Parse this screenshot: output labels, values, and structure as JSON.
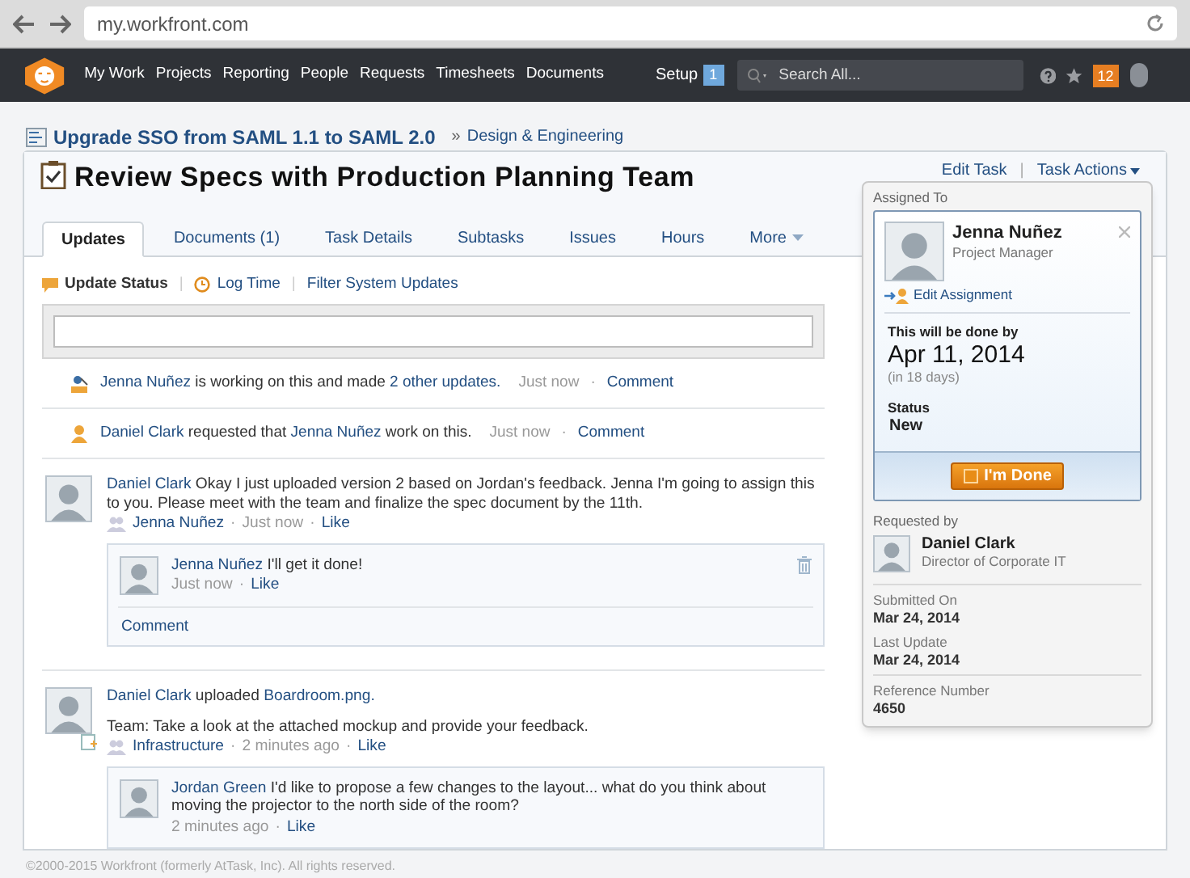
{
  "browser": {
    "url": "my.workfront.com"
  },
  "nav": {
    "items": [
      "My Work",
      "Projects",
      "Reporting",
      "People",
      "Requests",
      "Timesheets",
      "Documents"
    ],
    "setup": "Setup",
    "setup_badge": "1",
    "search_placeholder": "Search All...",
    "notification_count": "12"
  },
  "breadcrumb": {
    "project": "Upgrade SSO from SAML 1.1 to SAML 2.0",
    "separator": "»",
    "group": "Design & Engineering"
  },
  "task": {
    "title": "Review Specs with Production Planning Team",
    "actions": [
      "Edit Task",
      "Task Actions"
    ],
    "action_separator": "|"
  },
  "tabs": [
    {
      "label": "Updates",
      "selected": true
    },
    {
      "label": "Documents",
      "count": "(1)",
      "selected": false
    },
    {
      "label": "Task Details",
      "selected": false
    },
    {
      "label": "Subtasks",
      "selected": false
    },
    {
      "label": "Issues",
      "selected": false
    },
    {
      "label": "Hours",
      "selected": false
    },
    {
      "label": "More",
      "selected": false,
      "dropdown": true
    }
  ],
  "update_bar": {
    "actions": [
      {
        "kind": "status",
        "label": "Update Status",
        "selected": true
      },
      {
        "kind": "time",
        "label": "Log Time",
        "selected": false
      },
      {
        "kind": "filter",
        "label": "Filter System Updates",
        "selected": false
      }
    ],
    "separator": "|"
  },
  "feed": [
    {
      "kind": "system",
      "segments": [
        {
          "text": "Jenna Nuñez",
          "link": true
        },
        {
          "text": " is working on this and made ",
          "link": false
        },
        {
          "text": "2 other updates.",
          "link": true
        }
      ],
      "time": "Just now",
      "separator": "·",
      "action": "Comment"
    },
    {
      "kind": "system",
      "segments": [
        {
          "text": "Daniel Clark",
          "link": true
        },
        {
          "text": " requested that ",
          "link": false
        },
        {
          "text": "Jenna Nuñez",
          "link": true
        },
        {
          "text": " work on this.",
          "link": false
        }
      ],
      "time": "Just now",
      "separator": "·",
      "action": "Comment"
    },
    {
      "kind": "post",
      "segments": [
        {
          "text": "Daniel Clark",
          "link": true
        },
        {
          "text": " Okay I just uploaded version 2 based on Jordan's feedback. Jenna I'm going to assign this to you. Please meet with the team and finalize the spec document by the 11th.",
          "link": false
        }
      ],
      "tag": "Jenna Nuñez",
      "time": "Just now",
      "separator": "·",
      "like": "Like",
      "attachment": false,
      "replies": [
        {
          "author": "Jenna Nuñez",
          "text": " I'll get it done!",
          "meta": "Just now",
          "separator": "·",
          "like": "Like",
          "deletable": true
        }
      ],
      "comment": "Comment"
    },
    {
      "kind": "post",
      "segments": [
        {
          "text": "Daniel Clark",
          "link": true
        },
        {
          "text": " uploaded ",
          "link": false
        },
        {
          "text": "Boardroom.png.",
          "link": true
        }
      ],
      "body": "Team: Take a look at the attached mockup and provide your feedback.",
      "tag": "Infrastructure",
      "time": "2 minutes ago",
      "separator": "·",
      "like": "Like",
      "attachment": true,
      "replies": [
        {
          "author": "Jordan Green",
          "text": " I'd like to propose a few changes to the layout... what do you think about moving the projector to the north side of the room?",
          "meta": "2 minutes ago",
          "separator": "·",
          "like": "Like",
          "deletable": false
        }
      ]
    }
  ],
  "footer": "©2000-2015 Workfront (formerly AtTask, Inc). All rights reserved.",
  "panel": {
    "assigned_label": "Assigned To",
    "assignee": {
      "name": "Jenna Nuñez",
      "role": "Project Manager"
    },
    "edit_assignment": "Edit Assignment",
    "due_label": "This will be done by",
    "due_date": "Apr 11, 2014",
    "due_relative": "(in 18 days)",
    "status_label": "Status",
    "status": "New",
    "done_button": "I'm Done",
    "requested_label": "Requested by",
    "requester": {
      "name": "Daniel Clark",
      "role": "Director of Corporate IT"
    },
    "fields": [
      {
        "label": "Submitted On",
        "value": "Mar 24, 2014",
        "divider": false
      },
      {
        "label": "Last Update",
        "value": "Mar 24, 2014",
        "divider": false
      },
      {
        "label": "Reference Number",
        "value": "4650",
        "divider": true
      }
    ]
  }
}
